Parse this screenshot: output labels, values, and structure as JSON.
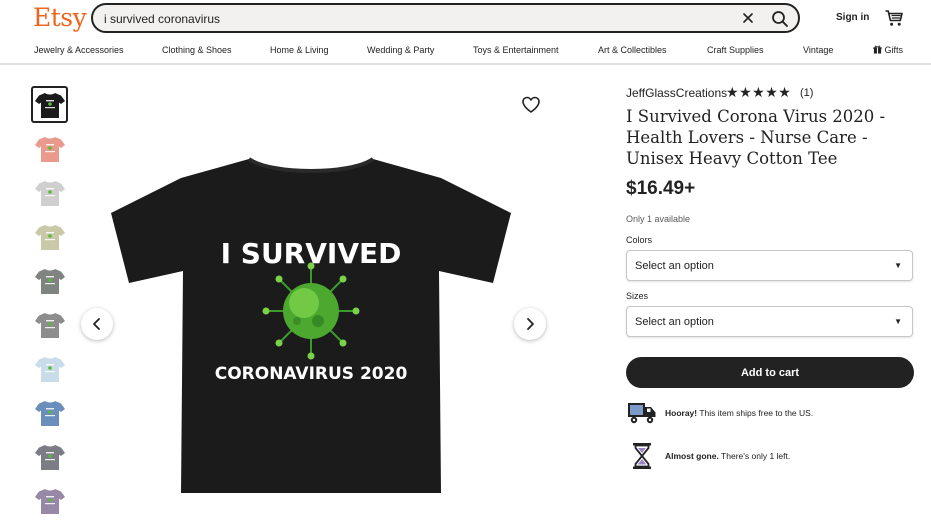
{
  "header": {
    "logo": "Etsy",
    "search_value": "i survived coronavirus",
    "signin_label": "Sign in",
    "cart_icon": "cart-icon",
    "brand_color": "#f1641e"
  },
  "nav": {
    "items": [
      "Jewelry & Accessories",
      "Clothing & Shoes",
      "Home & Living",
      "Wedding & Party",
      "Toys & Entertainment",
      "Art & Collectibles",
      "Craft Supplies",
      "Vintage",
      "Gifts"
    ]
  },
  "gallery": {
    "thumbnail_colors": [
      "#1b1b1b",
      "#e99a8c",
      "#cfcfcf",
      "#c9c9a8",
      "#7f8480",
      "#8d8d8d",
      "#c9dcea",
      "#6b8fbd",
      "#7c7c85",
      "#9888a8"
    ],
    "selected_index": 0,
    "main_image": {
      "line1": "I SURVIVED",
      "line2": "CORONAVIRUS 2020",
      "shirt_color": "#1b1b1b"
    }
  },
  "product": {
    "shop_name": "JeffGlassCreations",
    "rating_stars": 5,
    "review_count": "(1)",
    "title": "I Survived Corona Virus 2020 - Health Lovers - Nurse Care - Unisex Heavy Cotton Tee",
    "price": "$16.49+",
    "availability": "Only 1 available",
    "colors_label": "Colors",
    "colors_value": "Select an option",
    "sizes_label": "Sizes",
    "sizes_value": "Select an option",
    "add_to_cart": "Add to cart",
    "shipping_bold": "Hooray!",
    "shipping_text": " This item ships free to the US.",
    "stock_bold": "Almost gone.",
    "stock_text": " There's only 1 left."
  }
}
